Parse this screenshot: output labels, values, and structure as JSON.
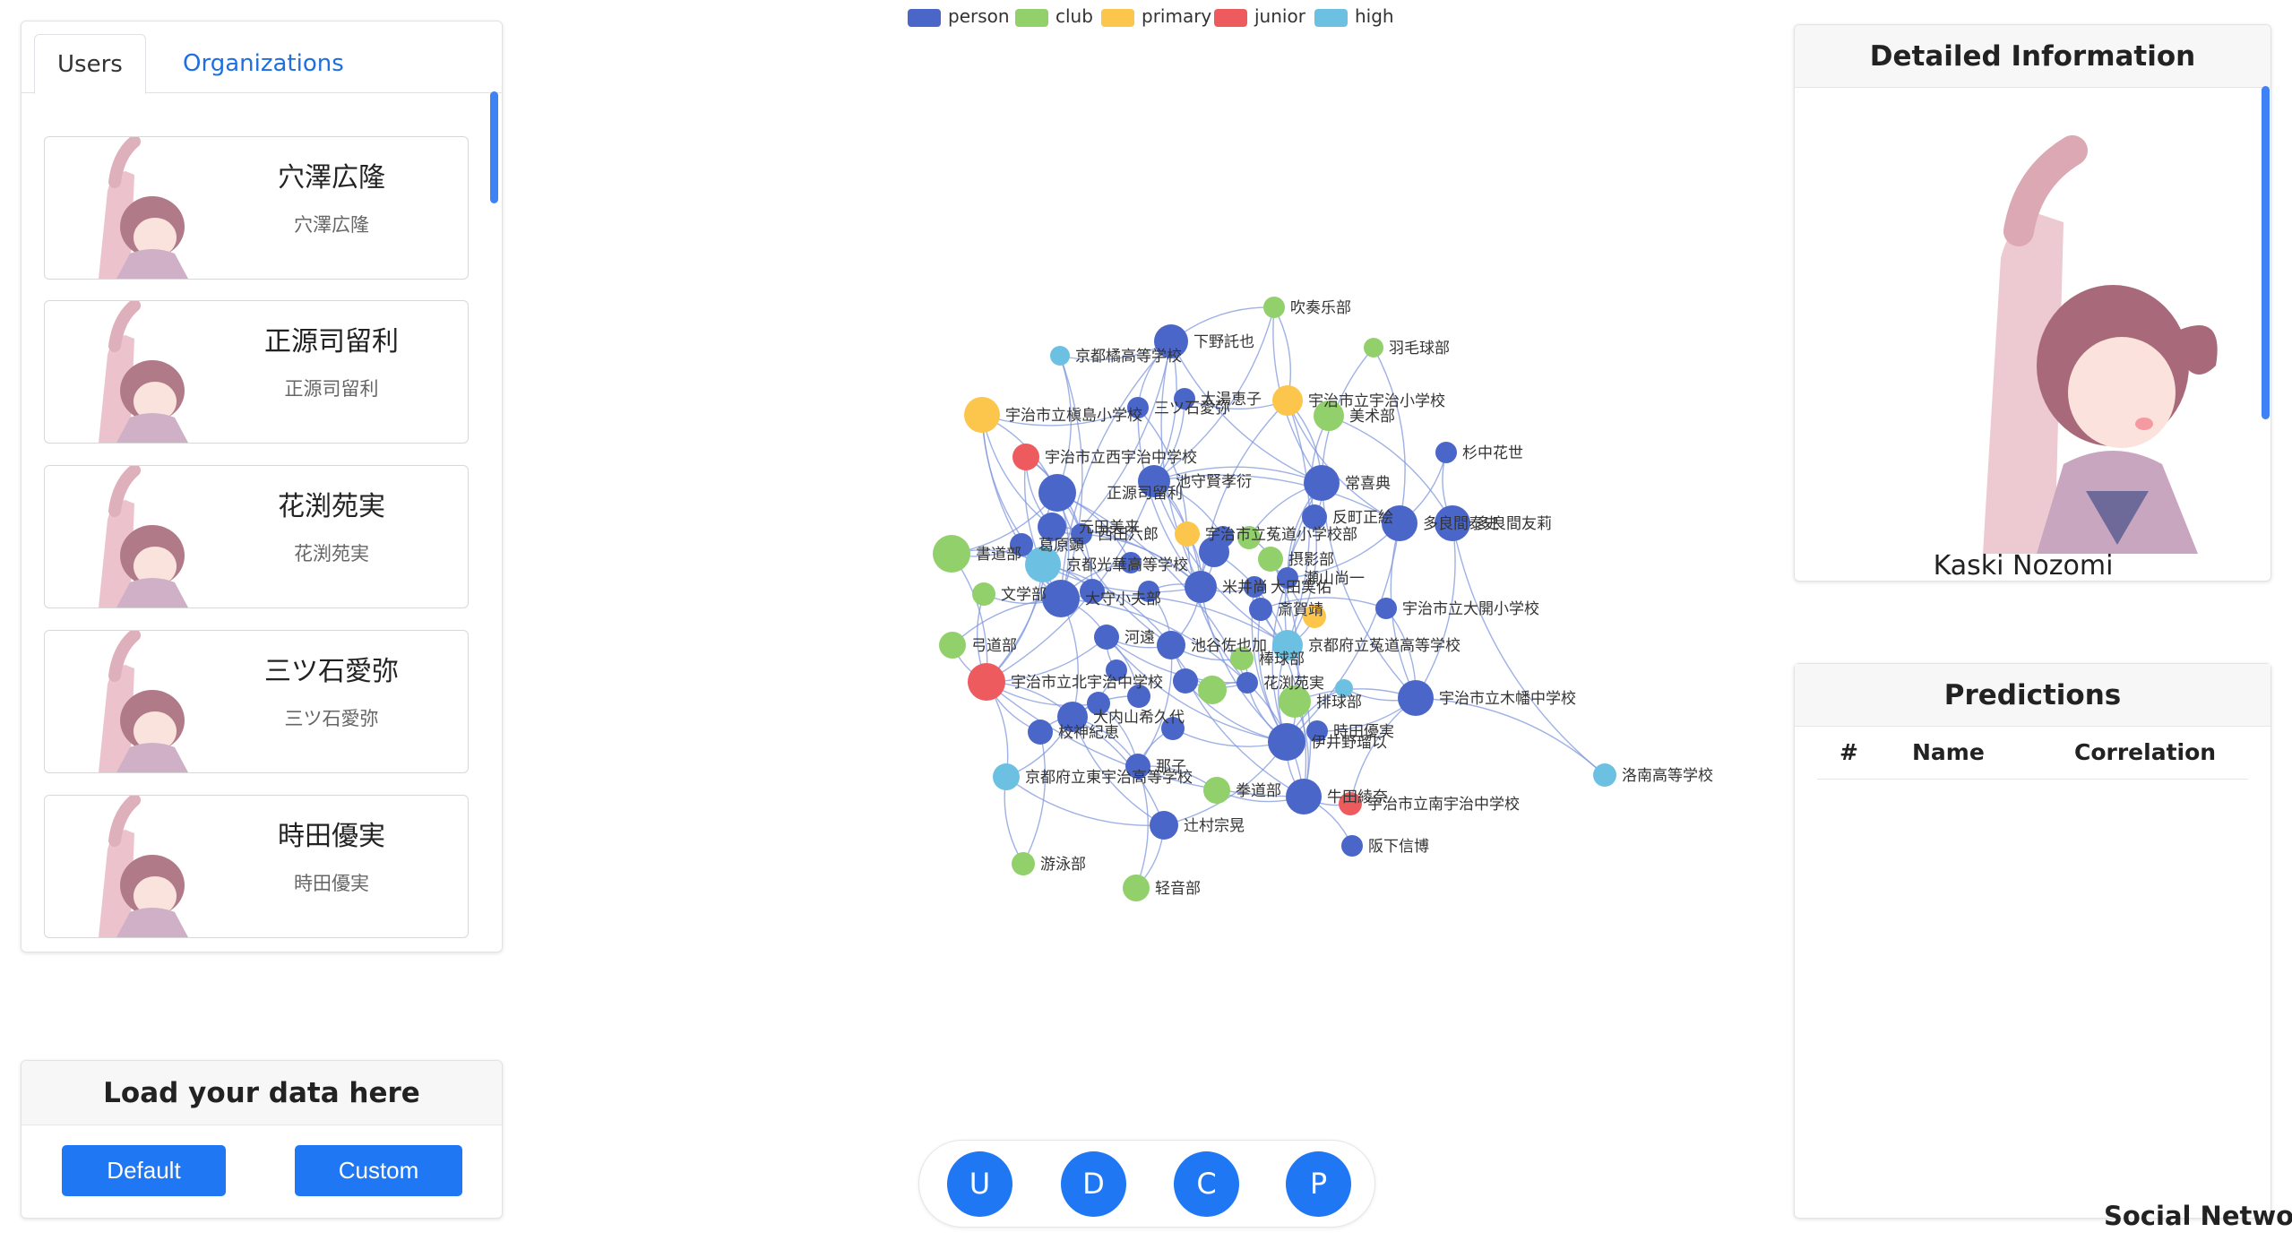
{
  "legend": [
    {
      "label": "person",
      "color": "#4a66c9"
    },
    {
      "label": "club",
      "color": "#92d06c"
    },
    {
      "label": "primary",
      "color": "#fcc54b"
    },
    {
      "label": "junior",
      "color": "#ee5b5e"
    },
    {
      "label": "high",
      "color": "#6cc1e2"
    }
  ],
  "users_panel": {
    "tabs": [
      {
        "label": "Users",
        "active": true
      },
      {
        "label": "Organizations",
        "active": false
      }
    ],
    "users": [
      {
        "name": "穴澤広隆",
        "subtitle": "穴澤広隆"
      },
      {
        "name": "正源司留利",
        "subtitle": "正源司留利"
      },
      {
        "name": "花渕苑実",
        "subtitle": "花渕苑実"
      },
      {
        "name": "三ツ石愛弥",
        "subtitle": "三ツ石愛弥"
      },
      {
        "name": "時田優実",
        "subtitle": "時田優実"
      }
    ]
  },
  "load_panel": {
    "title": "Load your data here",
    "default_label": "Default",
    "custom_label": "Custom"
  },
  "details_panel": {
    "title": "Detailed Information",
    "name": "Kaski Nozomi"
  },
  "predictions_panel": {
    "title": "Predictions",
    "columns": [
      "#",
      "Name",
      "Correlation"
    ]
  },
  "toolbar": {
    "buttons": [
      "U",
      "D",
      "C",
      "P"
    ]
  },
  "footer": {
    "title": "Social Network"
  },
  "graph": {
    "node_labels": [
      "吹奏乐部",
      "羽毛球部",
      "京都橘高等学校",
      "下野託也",
      "太湯恵子",
      "三ツ石愛弥",
      "宇治市立宇治小学校",
      "美术部",
      "宇治市立槇島小学校",
      "杉中花世",
      "宇治市立西宇治中学校",
      "池守賢孝衍",
      "常喜典",
      "正源司留利",
      "元田美来",
      "反町正絵",
      "西田六郎",
      "宇治市立菟道小学校部",
      "多良間泰史",
      "多良間友莉",
      "葛原顕",
      "書道部",
      "京都光華高等学校",
      "摂影部",
      "瀬山尚一",
      "米井尚",
      "大田実佑",
      "大守小夫部",
      "文学部",
      "斎賀靖",
      "宇治市立大開小学校",
      "河遠",
      "池谷佐也加",
      "京都府立菟道高等学校",
      "弓道部",
      "棒球部",
      "花渕苑実",
      "宇治市立北宇治中学校",
      "宇治市立木幡中学校",
      "排球部",
      "大内山希久代",
      "伊井野瑠以",
      "時田優実",
      "校神紀恵",
      "洛南高等学校",
      "京都府立東宇治高等学校",
      "那子",
      "拳道部",
      "牛田綾奈",
      "宇治市立南宇治中学校",
      "辻村宗晃",
      "阪下信博",
      "游泳部",
      "轻音部"
    ]
  }
}
